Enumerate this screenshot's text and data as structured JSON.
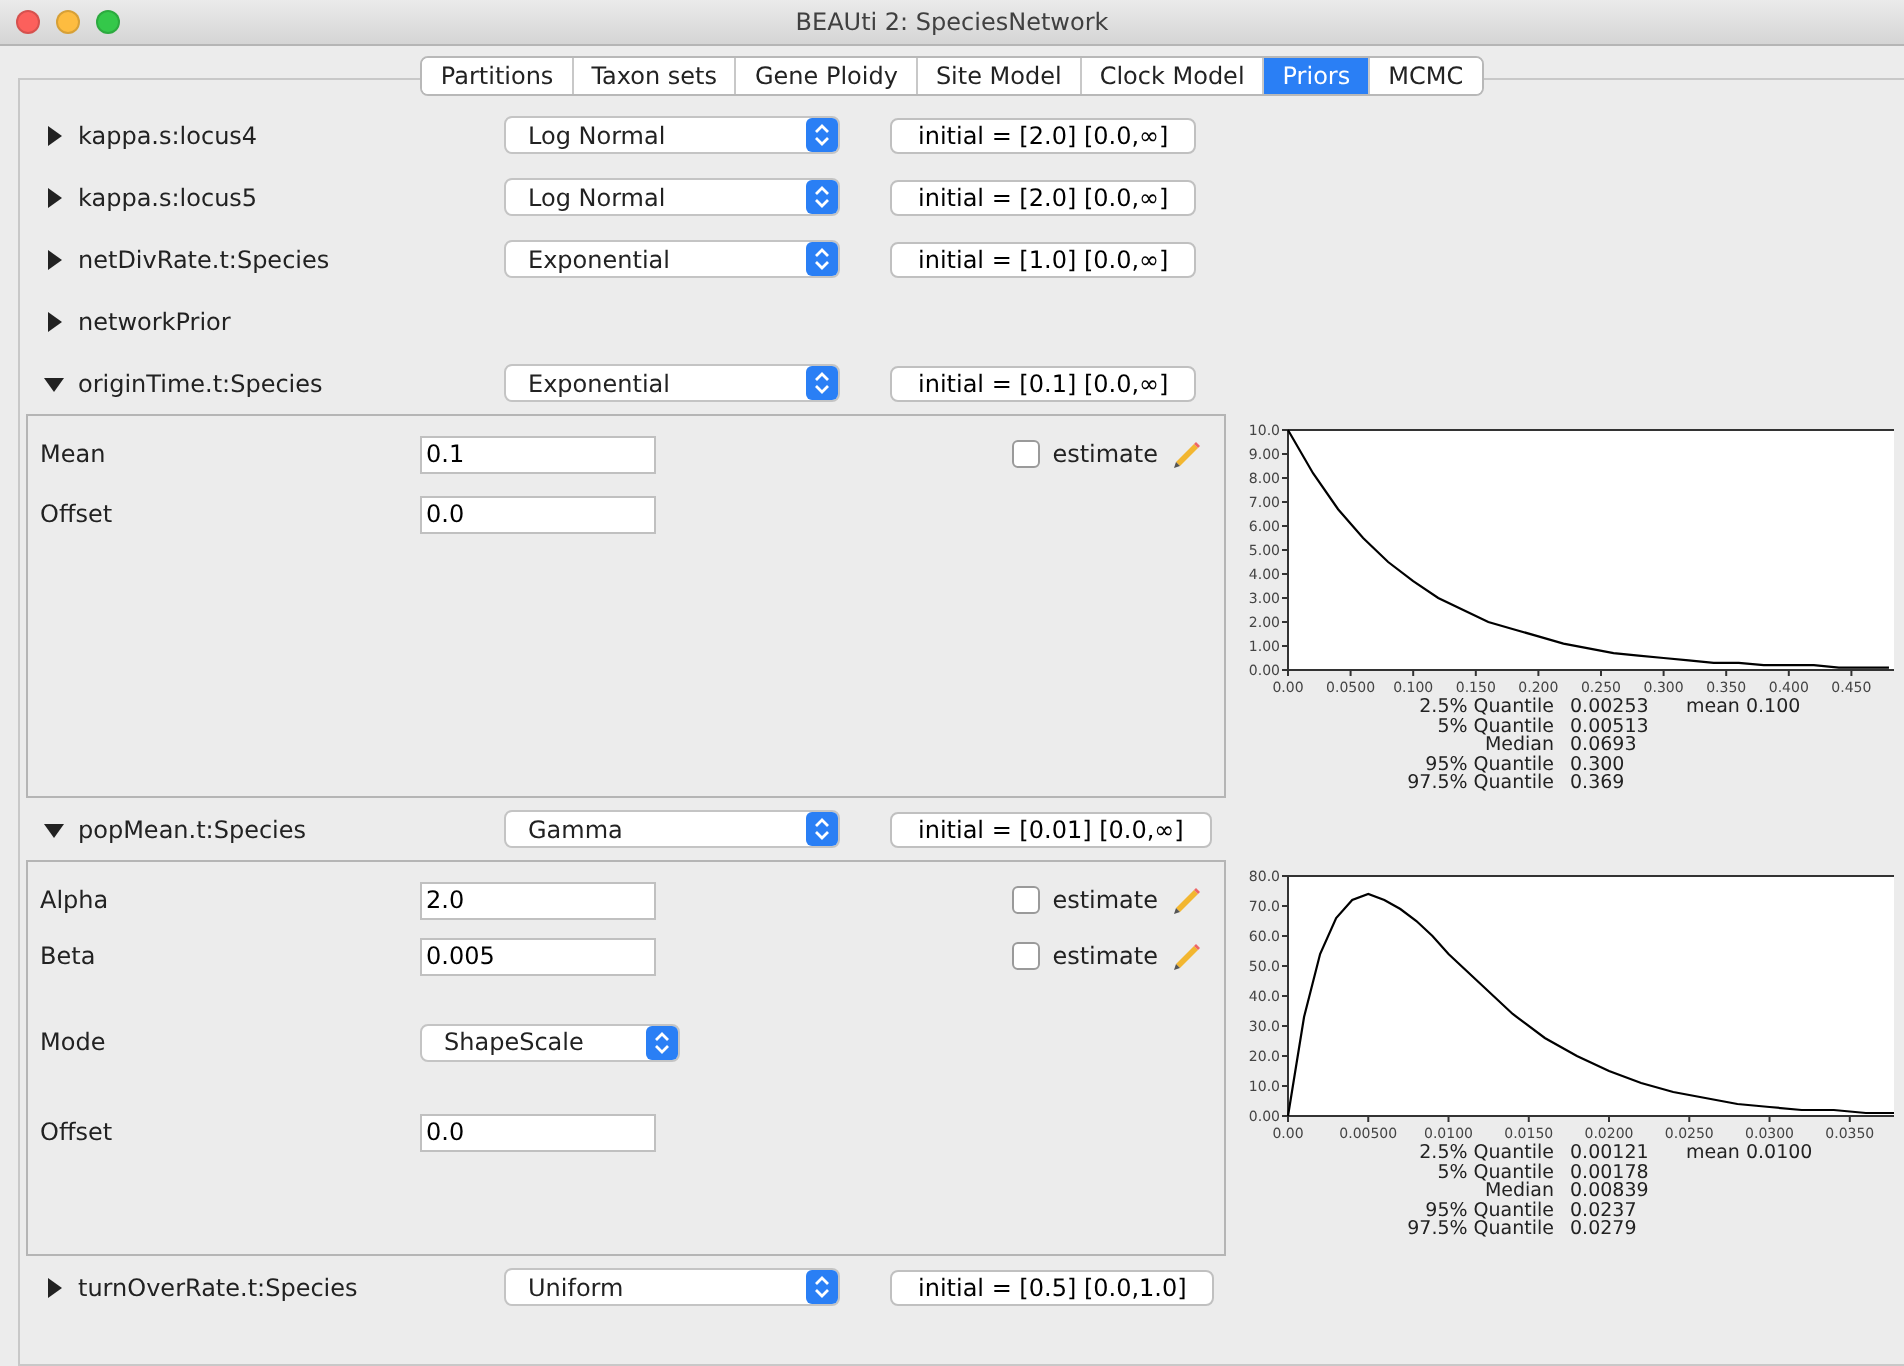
{
  "window": {
    "title": "BEAUti 2: SpeciesNetwork"
  },
  "tabs": [
    {
      "label": "Partitions",
      "selected": false
    },
    {
      "label": "Taxon sets",
      "selected": false
    },
    {
      "label": "Gene Ploidy",
      "selected": false
    },
    {
      "label": "Site Model",
      "selected": false
    },
    {
      "label": "Clock Model",
      "selected": false
    },
    {
      "label": "Priors",
      "selected": true
    },
    {
      "label": "MCMC",
      "selected": false
    }
  ],
  "priors": [
    {
      "name": "kappa.s:locus4",
      "expanded": false,
      "distribution": "Log Normal",
      "initial": "initial = [2.0] [0.0,∞]"
    },
    {
      "name": "kappa.s:locus5",
      "expanded": false,
      "distribution": "Log Normal",
      "initial": "initial = [2.0] [0.0,∞]"
    },
    {
      "name": "netDivRate.t:Species",
      "expanded": false,
      "distribution": "Exponential",
      "initial": "initial = [1.0] [0.0,∞]"
    },
    {
      "name": "networkPrior",
      "expanded": false
    },
    {
      "name": "originTime.t:Species",
      "expanded": true,
      "distribution": "Exponential",
      "initial": "initial = [0.1] [0.0,∞]",
      "params": [
        {
          "kind": "field",
          "label": "Mean",
          "value": "0.1",
          "estimate": {
            "label": "estimate",
            "checked": false
          }
        },
        {
          "kind": "field",
          "label": "Offset",
          "value": "0.0"
        }
      ],
      "chart_data": {
        "type": "line",
        "xlim": [
          0,
          0.5
        ],
        "ylim": [
          0,
          10
        ],
        "xticks": [
          {
            "value": 0,
            "label": "0.00"
          },
          {
            "value": 0.05,
            "label": "0.0500"
          },
          {
            "value": 0.1,
            "label": "0.100"
          },
          {
            "value": 0.15,
            "label": "0.150"
          },
          {
            "value": 0.2,
            "label": "0.200"
          },
          {
            "value": 0.25,
            "label": "0.250"
          },
          {
            "value": 0.3,
            "label": "0.300"
          },
          {
            "value": 0.35,
            "label": "0.350"
          },
          {
            "value": 0.4,
            "label": "0.400"
          },
          {
            "value": 0.45,
            "label": "0.450"
          }
        ],
        "yticks": [
          {
            "value": 0,
            "label": "0.00"
          },
          {
            "value": 1,
            "label": "1.00"
          },
          {
            "value": 2,
            "label": "2.00"
          },
          {
            "value": 3,
            "label": "3.00"
          },
          {
            "value": 4,
            "label": "4.00"
          },
          {
            "value": 5,
            "label": "5.00"
          },
          {
            "value": 6,
            "label": "6.00"
          },
          {
            "value": 7,
            "label": "7.00"
          },
          {
            "value": 8,
            "label": "8.00"
          },
          {
            "value": 9,
            "label": "9.00"
          },
          {
            "value": 10,
            "label": "10.0"
          }
        ],
        "x": [
          0,
          0.02,
          0.04,
          0.06,
          0.08,
          0.1,
          0.12,
          0.14,
          0.16,
          0.18,
          0.2,
          0.22,
          0.24,
          0.26,
          0.28,
          0.3,
          0.32,
          0.34,
          0.36,
          0.38,
          0.4,
          0.42,
          0.44,
          0.46,
          0.48
        ],
        "series": [
          {
            "color": "#000000",
            "values": [
              10,
              8.2,
              6.7,
              5.5,
              4.5,
              3.7,
              3.0,
              2.5,
              2.0,
              1.7,
              1.4,
              1.1,
              0.9,
              0.7,
              0.6,
              0.5,
              0.4,
              0.3,
              0.3,
              0.2,
              0.2,
              0.2,
              0.1,
              0.1,
              0.1
            ]
          }
        ]
      },
      "quantiles": [
        {
          "label": "2.5% Quantile",
          "value": "0.00253"
        },
        {
          "label": "5% Quantile",
          "value": "0.00513"
        },
        {
          "label": "Median",
          "value": "0.0693"
        },
        {
          "label": "95% Quantile",
          "value": "0.300"
        },
        {
          "label": "97.5% Quantile",
          "value": "0.369"
        }
      ],
      "mean": "mean 0.100"
    },
    {
      "name": "popMean.t:Species",
      "expanded": true,
      "distribution": "Gamma",
      "initial": "initial = [0.01] [0.0,∞]",
      "params": [
        {
          "kind": "field",
          "label": "Alpha",
          "value": "2.0",
          "estimate": {
            "label": "estimate",
            "checked": false
          }
        },
        {
          "kind": "field",
          "label": "Beta",
          "value": "0.005",
          "estimate": {
            "label": "estimate",
            "checked": false
          }
        },
        {
          "kind": "select",
          "label": "Mode",
          "value": "ShapeScale"
        },
        {
          "kind": "field",
          "label": "Offset",
          "value": "0.0"
        }
      ],
      "chart_data": {
        "type": "line",
        "xlim": [
          0,
          0.039
        ],
        "ylim": [
          0,
          80
        ],
        "xticks": [
          {
            "value": 0,
            "label": "0.00"
          },
          {
            "value": 0.005,
            "label": "0.00500"
          },
          {
            "value": 0.01,
            "label": "0.0100"
          },
          {
            "value": 0.015,
            "label": "0.0150"
          },
          {
            "value": 0.02,
            "label": "0.0200"
          },
          {
            "value": 0.025,
            "label": "0.0250"
          },
          {
            "value": 0.03,
            "label": "0.0300"
          },
          {
            "value": 0.035,
            "label": "0.0350"
          }
        ],
        "yticks": [
          {
            "value": 0,
            "label": "0.00"
          },
          {
            "value": 10,
            "label": "10.0"
          },
          {
            "value": 20,
            "label": "20.0"
          },
          {
            "value": 30,
            "label": "30.0"
          },
          {
            "value": 40,
            "label": "40.0"
          },
          {
            "value": 50,
            "label": "50.0"
          },
          {
            "value": 60,
            "label": "60.0"
          },
          {
            "value": 70,
            "label": "70.0"
          },
          {
            "value": 80,
            "label": "80.0"
          }
        ],
        "x": [
          0,
          0.001,
          0.002,
          0.003,
          0.004,
          0.005,
          0.006,
          0.007,
          0.008,
          0.009,
          0.01,
          0.012,
          0.014,
          0.016,
          0.018,
          0.02,
          0.022,
          0.024,
          0.026,
          0.028,
          0.03,
          0.032,
          0.034,
          0.036,
          0.038
        ],
        "series": [
          {
            "color": "#000000",
            "values": [
              0,
              33,
              54,
              66,
              72,
              74,
              72,
              69,
              65,
              60,
              54,
              44,
              34,
              26,
              20,
              15,
              11,
              8,
              6,
              4,
              3,
              2,
              2,
              1,
              1
            ]
          }
        ]
      },
      "quantiles": [
        {
          "label": "2.5% Quantile",
          "value": "0.00121"
        },
        {
          "label": "5% Quantile",
          "value": "0.00178"
        },
        {
          "label": "Median",
          "value": "0.00839"
        },
        {
          "label": "95% Quantile",
          "value": "0.0237"
        },
        {
          "label": "97.5% Quantile",
          "value": "0.0279"
        }
      ],
      "mean": "mean 0.0100"
    },
    {
      "name": "turnOverRate.t:Species",
      "expanded": false,
      "distribution": "Uniform",
      "initial": "initial = [0.5] [0.0,1.0]"
    }
  ]
}
